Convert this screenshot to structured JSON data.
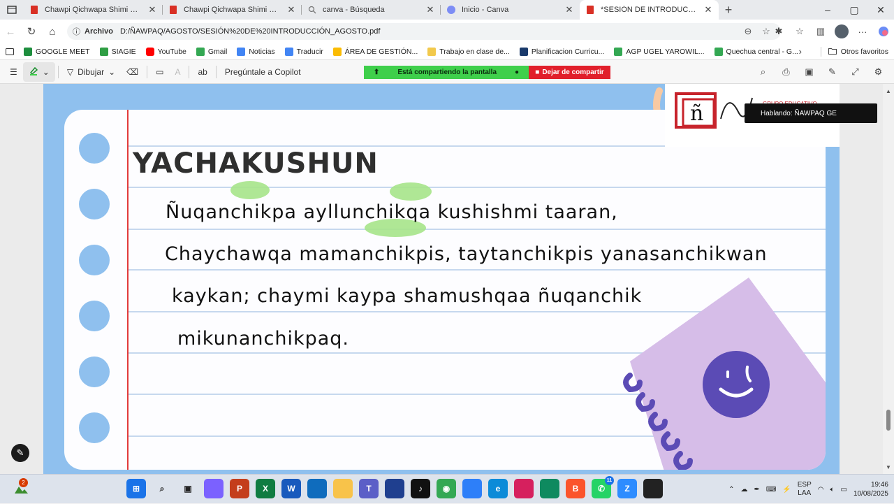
{
  "browser": {
    "tabs": [
      {
        "title": "Chawpi Qichwapa Shimi Qullqan...",
        "icon": "pdf-icon",
        "active": false
      },
      {
        "title": "Chawpi Qichwapa Shimi Qullqan...",
        "icon": "pdf-icon",
        "active": false
      },
      {
        "title": "canva - Búsqueda",
        "icon": "search-icon",
        "active": false
      },
      {
        "title": "Inicio - Canva",
        "icon": "canva-icon",
        "active": false
      },
      {
        "title": "*SESIÓN DE INTRODUCCIÓN_AGO...",
        "icon": "pdf-icon",
        "active": true
      }
    ],
    "address": {
      "chip": "Archivo",
      "url": "D:/ÑAWPAQ/AGOSTO/SESIÓN%20DE%20INTRODUCCIÓN_AGOSTO.pdf"
    },
    "bookmarks": [
      {
        "label": "GOOGLE MEET",
        "color": "#1e8e3e"
      },
      {
        "label": "SIAGIE",
        "color": "#2f9e44"
      },
      {
        "label": "YouTube",
        "color": "#ff0000"
      },
      {
        "label": "Gmail",
        "color": "#34a853"
      },
      {
        "label": "Noticias",
        "color": "#4285f4"
      },
      {
        "label": "Traducir",
        "color": "#4285f4"
      },
      {
        "label": "ÁREA DE GESTIÓN...",
        "color": "#fbbc04"
      },
      {
        "label": "Trabajo en clase de...",
        "color": "#f2c94c"
      },
      {
        "label": "Planificacion Curricu...",
        "color": "#1a3a6b"
      },
      {
        "label": "AGP UGEL YAROWIL...",
        "color": "#34a853"
      },
      {
        "label": "Quechua central - G...",
        "color": "#34a853"
      }
    ],
    "other_bookmarks": "Otros favoritos"
  },
  "pdf_toolbar": {
    "draw_label": "Dibujar",
    "copilot_label": "Pregúntale a Copilot",
    "sharing_label": "Está compartiendo la pantalla",
    "stop_sharing_label": "Dejar de compartir"
  },
  "document": {
    "heading": "YACHAKUSHUN",
    "lines": [
      "Ñuqanchikpa ayllunchikqa kushishmi taaran,",
      "Chaychawqa mamanchikpis, taytanchikpis yanasanchikwan",
      "kaykan; chaymi kaypa shamushqaa ñuqanchik",
      "mikunanchikpaq."
    ],
    "logo_text": "GRUPO EDUCATIVO",
    "logo_letter": "ñ"
  },
  "overlay": {
    "speaking": "Hablando: ÑAWPAQ GE"
  },
  "taskbar": {
    "weather_badge": "2",
    "whatsapp_badge": "11",
    "lang_top": "ESP",
    "lang_bottom": "LAA",
    "time": "19:46",
    "date": "10/08/2025",
    "apps": [
      {
        "name": "windows-start",
        "color": "#1a73e8"
      },
      {
        "name": "search",
        "color": "#00000000"
      },
      {
        "name": "task-view",
        "color": "#00000000"
      },
      {
        "name": "copilot",
        "color": "#7b61ff"
      },
      {
        "name": "powerpoint",
        "color": "#c43e1c"
      },
      {
        "name": "excel",
        "color": "#107c41"
      },
      {
        "name": "word",
        "color": "#185abd"
      },
      {
        "name": "snipping-tool",
        "color": "#0f6cbd"
      },
      {
        "name": "file-explorer",
        "color": "#f8c34a"
      },
      {
        "name": "teams",
        "color": "#5b5fc7"
      },
      {
        "name": "app-blue",
        "color": "#1f3f8f"
      },
      {
        "name": "tiktok",
        "color": "#111111"
      },
      {
        "name": "chrome",
        "color": "#34a853"
      },
      {
        "name": "photos",
        "color": "#2d7ff9"
      },
      {
        "name": "edge",
        "color": "#0c8bd8"
      },
      {
        "name": "app-pink",
        "color": "#d6205e"
      },
      {
        "name": "app-green",
        "color": "#0e8a5f"
      },
      {
        "name": "brave",
        "color": "#fb542b"
      },
      {
        "name": "whatsapp",
        "color": "#25d366"
      },
      {
        "name": "zoom",
        "color": "#2d8cff"
      },
      {
        "name": "obs",
        "color": "#222222"
      }
    ]
  }
}
